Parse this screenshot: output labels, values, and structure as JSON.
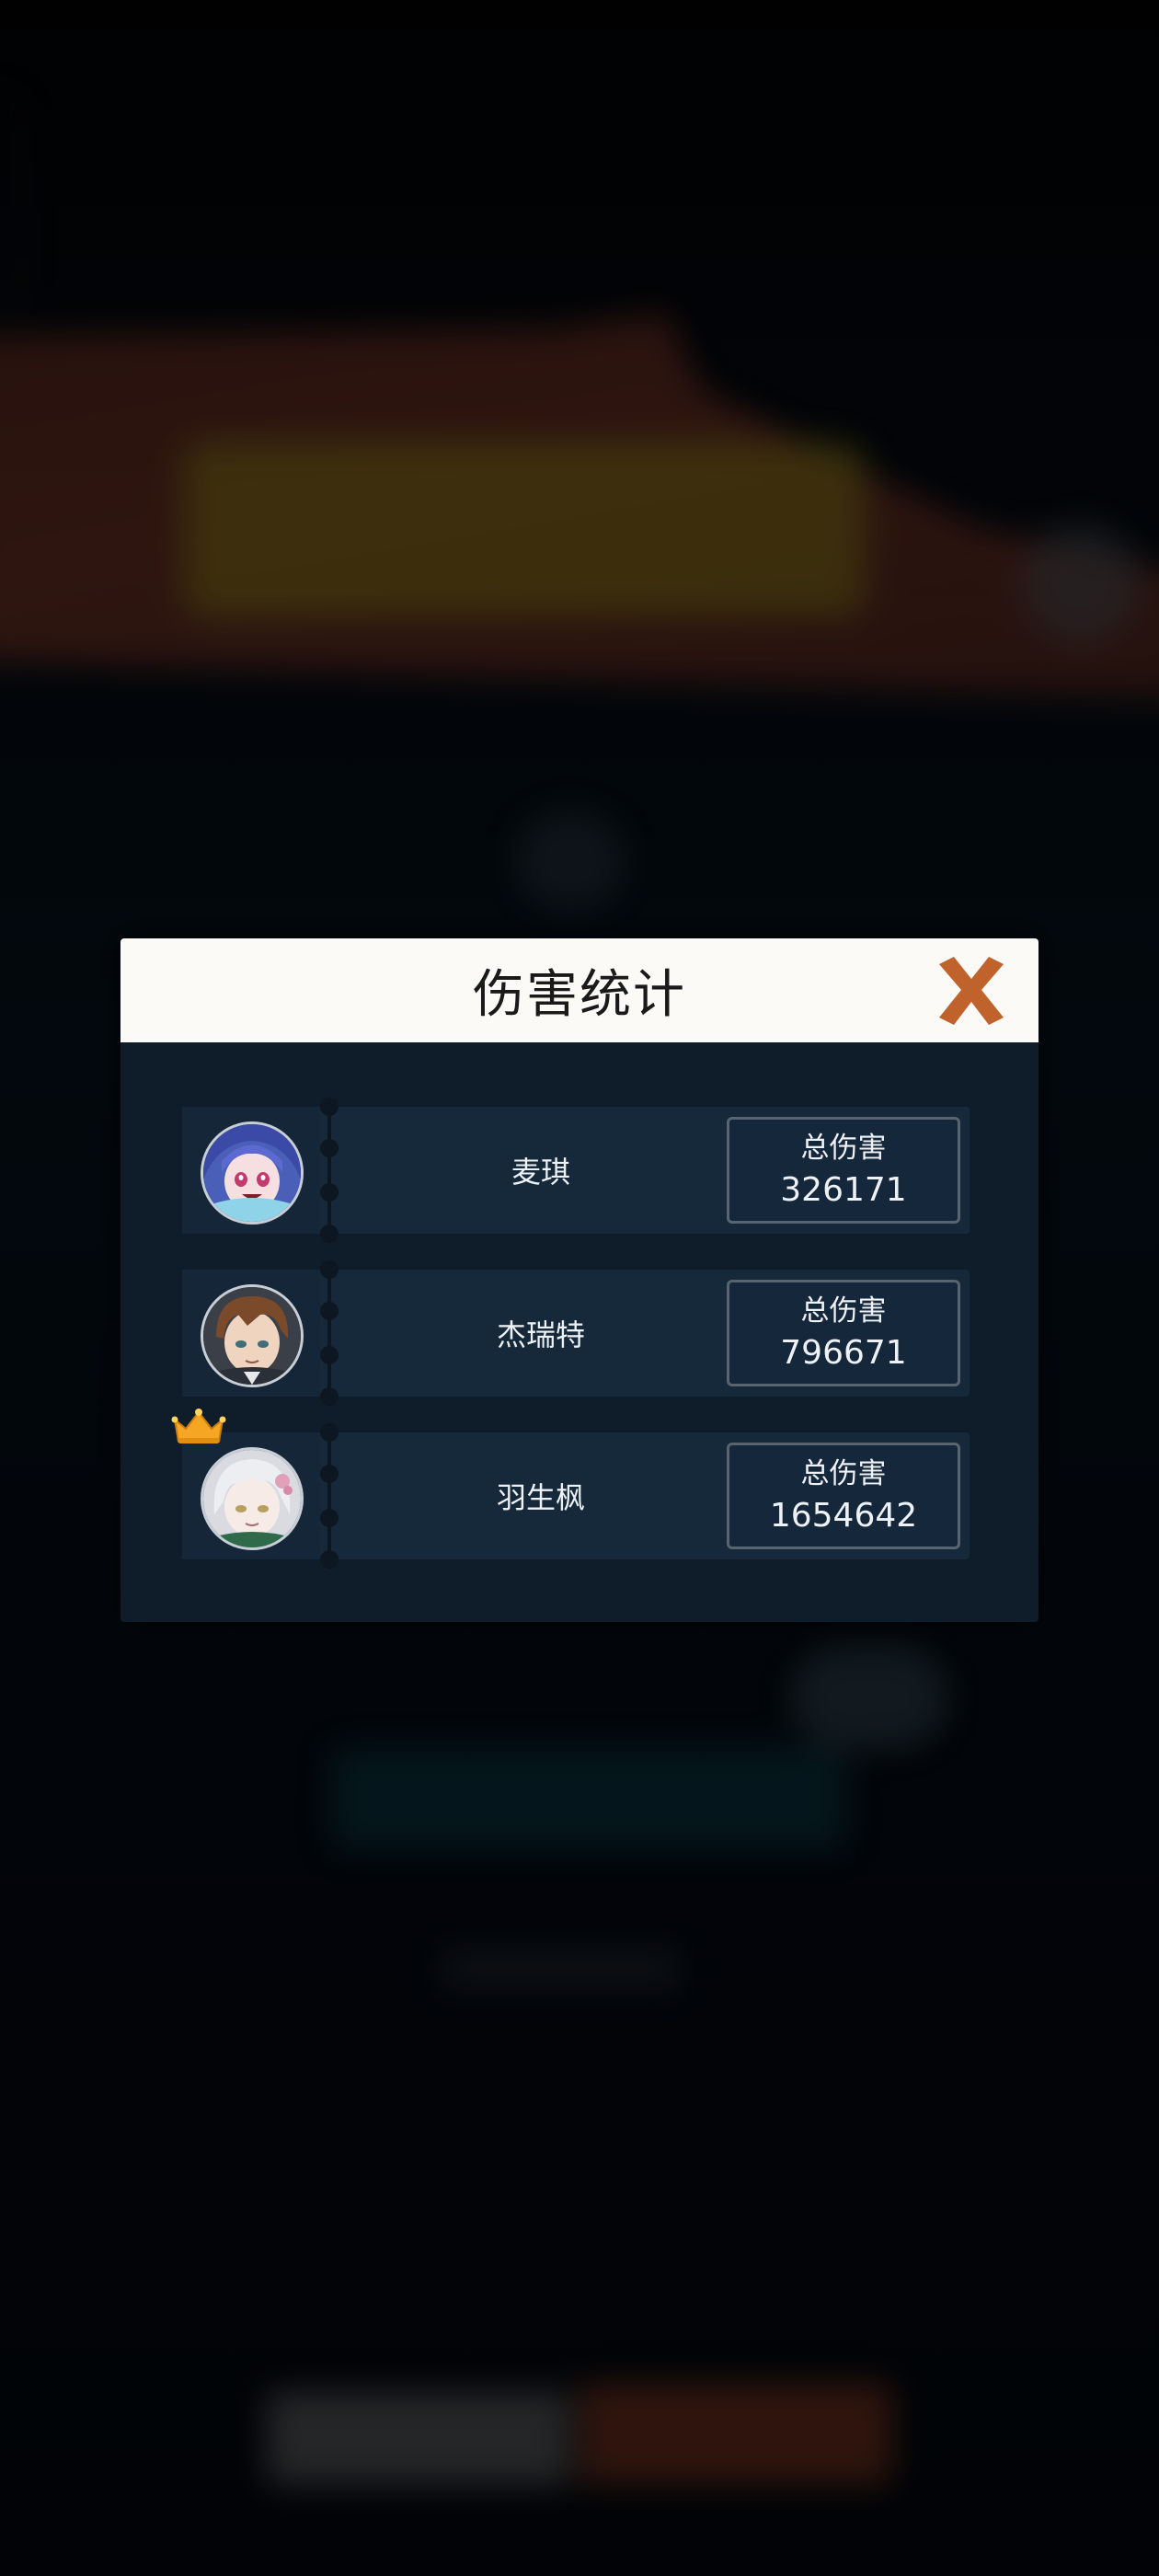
{
  "dialog": {
    "title": "伤害统计",
    "close_icon": "close-x-icon",
    "damage_label": "总伤害"
  },
  "players": [
    {
      "name": "麦琪",
      "damage_label": "总伤害",
      "damage": "326171",
      "avatar_icon": "avatar-purple-hair-girl",
      "has_crown": false
    },
    {
      "name": "杰瑞特",
      "damage_label": "总伤害",
      "damage": "796671",
      "avatar_icon": "avatar-brown-hair-man",
      "has_crown": false
    },
    {
      "name": "羽生枫",
      "damage_label": "总伤害",
      "damage": "1654642",
      "avatar_icon": "avatar-white-hair-girl",
      "has_crown": true
    }
  ],
  "colors": {
    "header_bg": "#fbfaf6",
    "panel_bg": "#0f1c29",
    "row_bg": "#16293a",
    "close_icon": "#c0622c",
    "crown": "#f5a623"
  }
}
